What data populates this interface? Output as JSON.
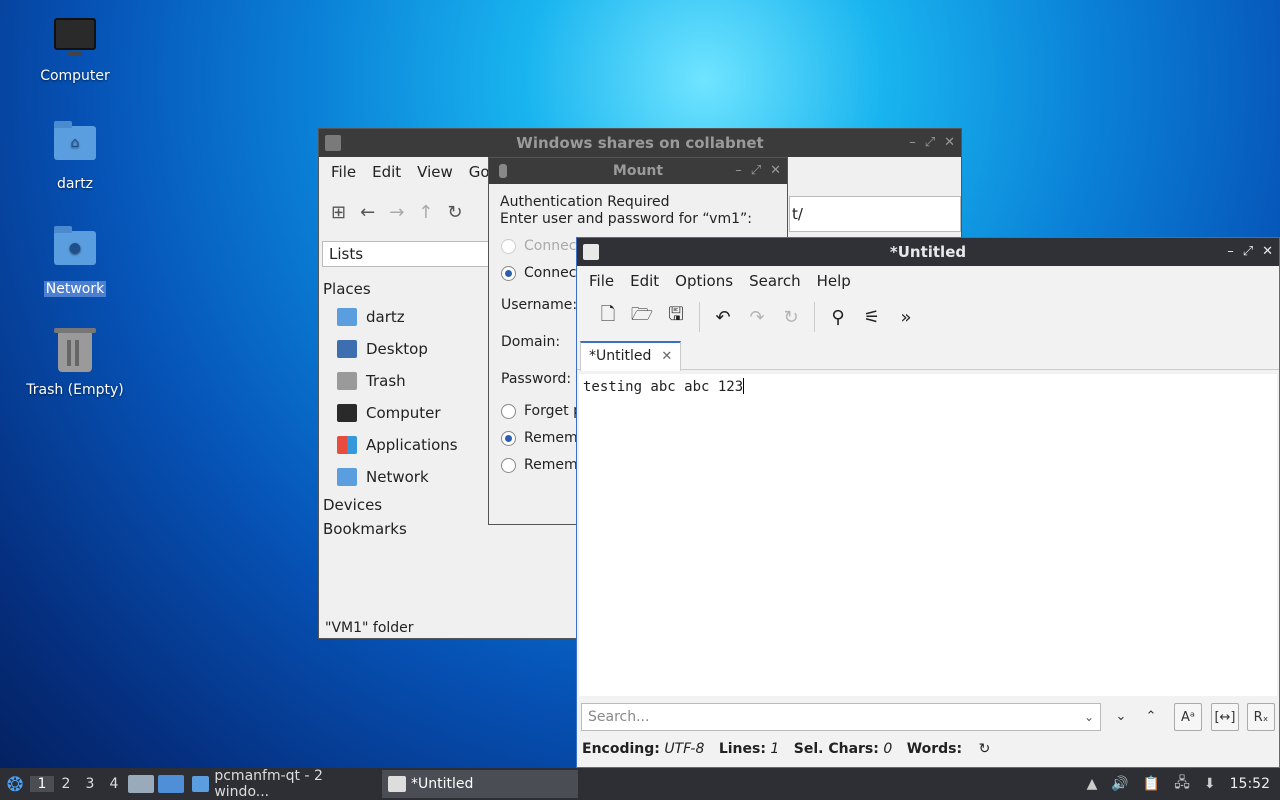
{
  "desktop": {
    "icons": [
      {
        "label": "Computer",
        "type": "computer"
      },
      {
        "label": "dartz",
        "type": "home-folder"
      },
      {
        "label": "Network",
        "type": "network-folder"
      },
      {
        "label": "Trash (Empty)",
        "type": "trash"
      }
    ]
  },
  "filemanager": {
    "title": "Windows shares on collabnet",
    "menu": [
      "File",
      "Edit",
      "View",
      "Go"
    ],
    "view_mode": "Lists",
    "places_header": "Places",
    "places": [
      "dartz",
      "Desktop",
      "Trash",
      "Computer",
      "Applications",
      "Network"
    ],
    "devices_header": "Devices",
    "bookmarks_header": "Bookmarks",
    "path_fragment": "t/",
    "status": "\"VM1\" folder"
  },
  "mount": {
    "title": "Mount",
    "heading": "Authentication Required",
    "prompt": "Enter user and password for “vm1”:",
    "connect_options": [
      "Connect",
      "Connect"
    ],
    "username_label": "Username:",
    "domain_label": "Domain:",
    "password_label": "Password:",
    "remember_options": [
      "Forget p",
      "Remem",
      "Remem"
    ]
  },
  "editor": {
    "title": "*Untitled",
    "menu": [
      "File",
      "Edit",
      "Options",
      "Search",
      "Help"
    ],
    "tab_label": "*Untitled",
    "content": "testing abc abc 123",
    "search_placeholder": "Search...",
    "status": {
      "encoding_label": "Encoding:",
      "encoding_value": "UTF-8",
      "lines_label": "Lines:",
      "lines_value": "1",
      "sel_label": "Sel. Chars:",
      "sel_value": "0",
      "words_label": "Words:"
    }
  },
  "taskbar": {
    "desktops": [
      "1",
      "2",
      "3",
      "4"
    ],
    "tasks": [
      "pcmanfm-qt - 2 windo...",
      "*Untitled"
    ],
    "clock": "15:52"
  },
  "colors": {
    "accent": "#3b6fc7",
    "titlebar_active": "#2f3136",
    "taskbar": "#2d2f34"
  }
}
